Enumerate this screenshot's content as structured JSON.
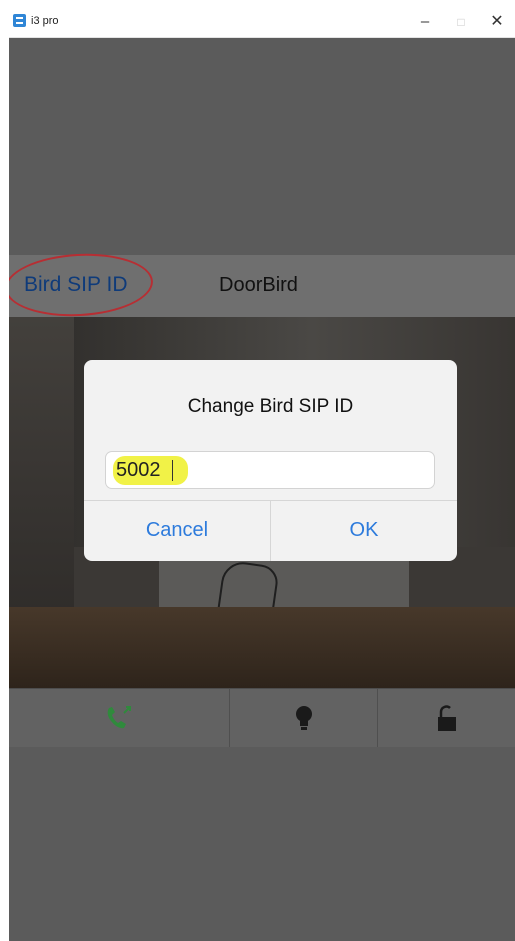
{
  "window": {
    "title": "i3 pro",
    "controls": {
      "minimize": "–",
      "maximize": "□",
      "close": "✕"
    }
  },
  "nav": {
    "back_label": "Bird SIP ID",
    "title": "DoorBird"
  },
  "dialog": {
    "title": "Change Bird SIP ID",
    "input_value": "5002",
    "cancel_label": "Cancel",
    "ok_label": "OK"
  },
  "toolbar": {
    "buttons": [
      {
        "name": "call",
        "icon": "phone-icon",
        "color": "#2f8a3c"
      },
      {
        "name": "light",
        "icon": "lightbulb-icon",
        "color": "#1a1a1a"
      },
      {
        "name": "unlock",
        "icon": "unlock-icon",
        "color": "#1a1a1a"
      }
    ]
  },
  "colors": {
    "accent": "#2d7bdc",
    "back_link": "#0f3b7a",
    "highlight": "#f1f247",
    "annotation": "#b72e33"
  }
}
